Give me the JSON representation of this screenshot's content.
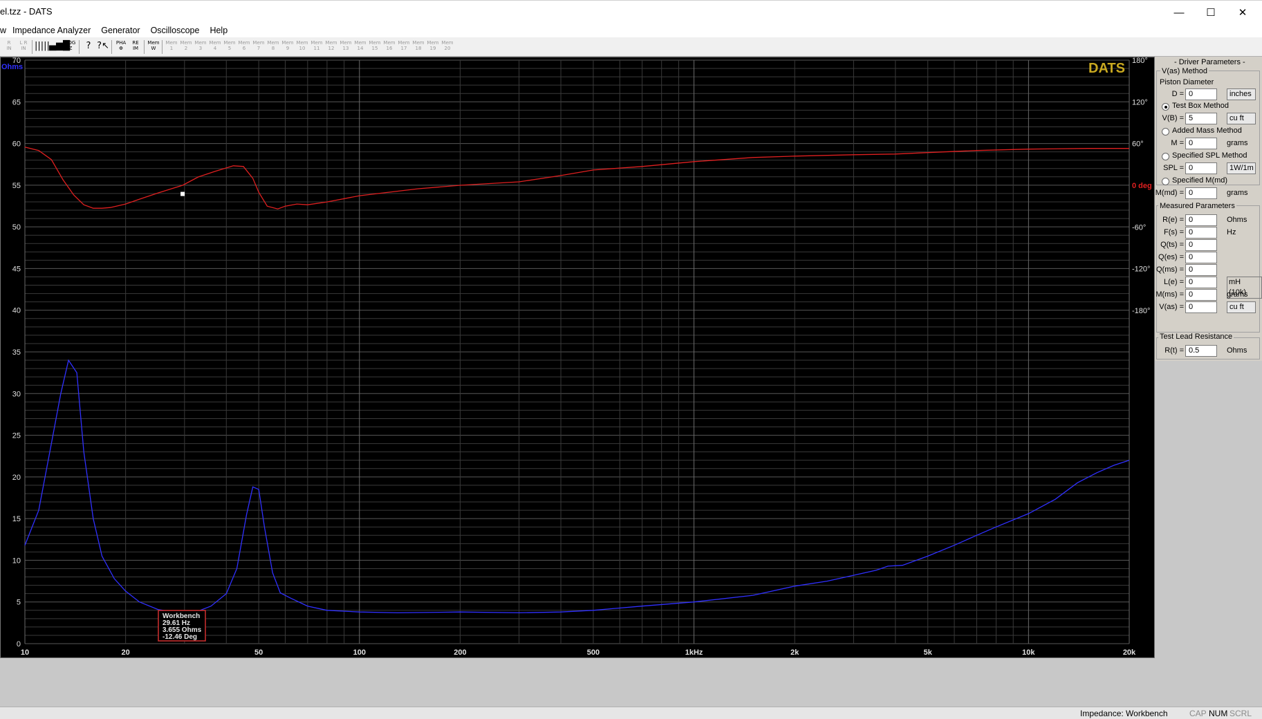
{
  "window": {
    "title": "el.tzz - DATS",
    "minimize_glyph": "—",
    "maximize_glyph": "☐",
    "close_glyph": "✕"
  },
  "menu": [
    "w",
    "Impedance Analyzer",
    "Generator",
    "Oscilloscope",
    "Help"
  ],
  "toolbar": {
    "buttons": [
      {
        "label": "R\nIN",
        "active": false
      },
      {
        "label": "L R\nIN",
        "active": false
      },
      {
        "label": "|||||",
        "active": true
      },
      {
        "label": "▄▆█",
        "active": true
      },
      {
        "label": "LOG\nZ",
        "active": true
      },
      {
        "label": "?",
        "active": true
      },
      {
        "label": "?↖",
        "active": true
      },
      {
        "label": "PHA\nΦ",
        "active": true
      },
      {
        "label": "RE\nIM",
        "active": true
      },
      {
        "label": "Mem\nW",
        "active": true
      },
      {
        "label": "Mem\n1",
        "active": false
      },
      {
        "label": "Mem\n2",
        "active": false
      },
      {
        "label": "Mem\n3",
        "active": false
      },
      {
        "label": "Mem\n4",
        "active": false
      },
      {
        "label": "Mem\n5",
        "active": false
      },
      {
        "label": "Mem\n6",
        "active": false
      },
      {
        "label": "Mem\n7",
        "active": false
      },
      {
        "label": "Mem\n8",
        "active": false
      },
      {
        "label": "Mem\n9",
        "active": false
      },
      {
        "label": "Mem\n10",
        "active": false
      },
      {
        "label": "Mem\n11",
        "active": false
      },
      {
        "label": "Mem\n12",
        "active": false
      },
      {
        "label": "Mem\n13",
        "active": false
      },
      {
        "label": "Mem\n14",
        "active": false
      },
      {
        "label": "Mem\n15",
        "active": false
      },
      {
        "label": "Mem\n16",
        "active": false
      },
      {
        "label": "Mem\n17",
        "active": false
      },
      {
        "label": "Mem\n18",
        "active": false
      },
      {
        "label": "Mem\n19",
        "active": false
      },
      {
        "label": "Mem\n20",
        "active": false
      }
    ]
  },
  "chart_data": {
    "type": "line",
    "brand_label": "DATS",
    "x_scale": "log",
    "xlim": [
      10,
      20000
    ],
    "x_ticks": [
      10,
      20,
      50,
      100,
      200,
      500,
      1000,
      2000,
      5000,
      10000,
      20000
    ],
    "x_tick_labels": [
      "10",
      "20",
      "50",
      "100",
      "200",
      "500",
      "1kHz",
      "2k",
      "5k",
      "10k",
      "20k"
    ],
    "ylabel": "Ohms",
    "ylim": [
      0,
      70
    ],
    "y_ticks": [
      0,
      5,
      10,
      15,
      20,
      25,
      30,
      35,
      40,
      45,
      50,
      55,
      60,
      65,
      70
    ],
    "y2label": "deg",
    "y2lim": [
      -180,
      180
    ],
    "y2_ticks": [
      "180°",
      "120°",
      "60°",
      "0 deg",
      "-60°",
      "-120°",
      "-180°"
    ],
    "grid": true,
    "colors": {
      "impedance": "#3030ff",
      "phase": "#e02020",
      "brand": "#c8a820",
      "grid": "#3a3a3a",
      "grid_major": "#585858"
    },
    "series": [
      {
        "key": "impedance",
        "axis": "left",
        "x": [
          10,
          11,
          12,
          12.8,
          13.5,
          14.3,
          15,
          16,
          17,
          18.5,
          20,
          22,
          25,
          29.61,
          32,
          36,
          40,
          43,
          46,
          48,
          50,
          52,
          55,
          58,
          62,
          70,
          80,
          100,
          130,
          200,
          300,
          400,
          500,
          700,
          1000,
          1500,
          2000,
          2500,
          3000,
          3500,
          3800,
          4200,
          5000,
          6000,
          7000,
          8000,
          10000,
          12000,
          14000,
          16000,
          18000,
          20000
        ],
        "y": [
          11.8,
          16,
          24,
          30,
          34,
          32.5,
          23,
          15,
          10.5,
          7.8,
          6.3,
          5.0,
          4.1,
          3.65,
          3.7,
          4.5,
          6.0,
          9.0,
          15.5,
          18.8,
          18.5,
          14,
          8.5,
          6.1,
          5.5,
          4.5,
          4.0,
          3.8,
          3.7,
          3.8,
          3.7,
          3.8,
          4.0,
          4.5,
          5.0,
          5.8,
          6.9,
          7.5,
          8.2,
          8.8,
          9.3,
          9.4,
          10.5,
          11.8,
          13.0,
          14.0,
          15.6,
          17.3,
          19.3,
          20.5,
          21.4,
          22.0
        ]
      },
      {
        "key": "phase",
        "axis": "right",
        "x": [
          10,
          11,
          12,
          13,
          14,
          15,
          16,
          17,
          18,
          20,
          22,
          25,
          29.61,
          33,
          37,
          42,
          45,
          48,
          50,
          53,
          57,
          60,
          65,
          70,
          80,
          100,
          150,
          200,
          300,
          400,
          500,
          700,
          1000,
          1500,
          2000,
          3000,
          4000,
          5000,
          7000,
          10000,
          15000,
          20000
        ],
        "y": [
          55,
          50,
          37,
          8,
          -14,
          -28,
          -33,
          -33,
          -32,
          -27,
          -20,
          -11,
          0,
          12,
          20,
          28,
          27,
          10,
          -10,
          -30,
          -34,
          -30,
          -27,
          -28,
          -24,
          -15,
          -5,
          0,
          5,
          14,
          22,
          27,
          34,
          40,
          42,
          44,
          45,
          47,
          50,
          52,
          53,
          53
        ]
      }
    ],
    "cursor": {
      "x": 29.61,
      "phase": -12.46
    },
    "readout": {
      "title": "Workbench",
      "freq": "29.61 Hz",
      "ohms": "3.655 Ohms",
      "deg": "-12.46 Deg"
    }
  },
  "panel": {
    "title": "- Driver Parameters -",
    "vas_group": "V(as) Method",
    "piston_label": "Piston Diameter",
    "d_label": "D =",
    "d_value": "0",
    "d_unit": "inches",
    "test_box": "Test Box Method",
    "vb_label": "V(B) =",
    "vb_value": "5",
    "vb_unit": "cu ft",
    "added_mass": "Added Mass Method",
    "m_label": "M =",
    "m_value": "0",
    "m_unit": "grams",
    "spl_method": "Specified SPL Method",
    "spl_label": "SPL =",
    "spl_value": "0",
    "spl_unit": "1W/1m",
    "mmd_method": "Specified M(md)",
    "mmd_label": "M(md) =",
    "mmd_value": "0",
    "mmd_unit": "grams",
    "measured_title": "Measured Parameters",
    "measured": [
      {
        "label": "R(e) =",
        "value": "0",
        "unit": "Ohms"
      },
      {
        "label": "F(s) =",
        "value": "0",
        "unit": "Hz"
      },
      {
        "label": "Q(ts) =",
        "value": "0",
        "unit": ""
      },
      {
        "label": "Q(es) =",
        "value": "0",
        "unit": ""
      },
      {
        "label": "Q(ms) =",
        "value": "0",
        "unit": ""
      },
      {
        "label": "L(e) =",
        "value": "0",
        "unit": "mH (10k)"
      },
      {
        "label": "M(ms) =",
        "value": "0",
        "unit": "grams"
      },
      {
        "label": "V(as) =",
        "value": "0",
        "unit": "cu ft"
      }
    ],
    "lead_title": "Test Lead Resistance",
    "rt_label": "R(t) =",
    "rt_value": "0.5",
    "rt_unit": "Ohms"
  },
  "status": {
    "mode": "Impedance: Workbench",
    "cap": "CAP",
    "num": "NUM",
    "scrl": "SCRL"
  }
}
